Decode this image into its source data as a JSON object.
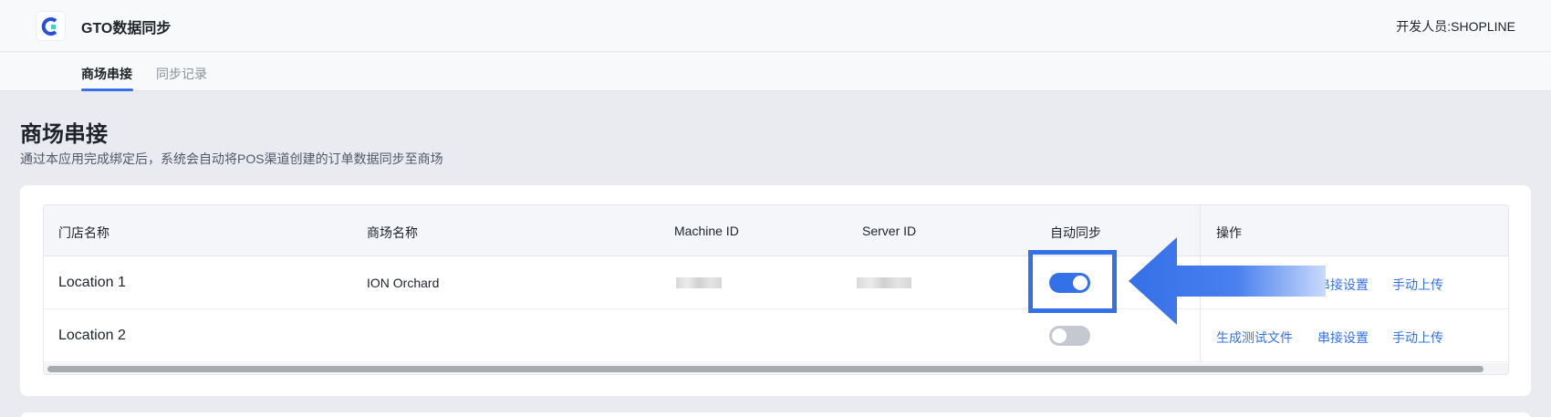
{
  "header": {
    "app_title": "GTO数据同步",
    "developer": "开发人员:SHOPLINE"
  },
  "tabs": [
    {
      "label": "商场串接",
      "active": true
    },
    {
      "label": "同步记录",
      "active": false
    }
  ],
  "page": {
    "title": "商场串接",
    "description": "通过本应用完成绑定后，系统会自动将POS渠道创建的订单数据同步至商场"
  },
  "table": {
    "columns": [
      "门店名称",
      "商场名称",
      "Machine ID",
      "Server ID",
      "自动同步",
      "操作"
    ],
    "rows": [
      {
        "store": "Location 1",
        "mall": "ION Orchard",
        "machine_id_masked": true,
        "server_id_masked": true,
        "auto_sync": true,
        "actions": [
          "串接设置",
          "手动上传"
        ]
      },
      {
        "store": "Location 2",
        "mall": "",
        "machine_id_masked": false,
        "server_id_masked": false,
        "auto_sync": false,
        "actions": [
          "生成测试文件",
          "串接设置",
          "手动上传"
        ]
      }
    ]
  },
  "colors": {
    "accent": "#3470e8",
    "toggle_off": "#c4c8d1",
    "page_bg": "#e9ebf0"
  },
  "icons": {
    "logo": "app-logo-icon",
    "annotation": "arrow-left-icon"
  }
}
